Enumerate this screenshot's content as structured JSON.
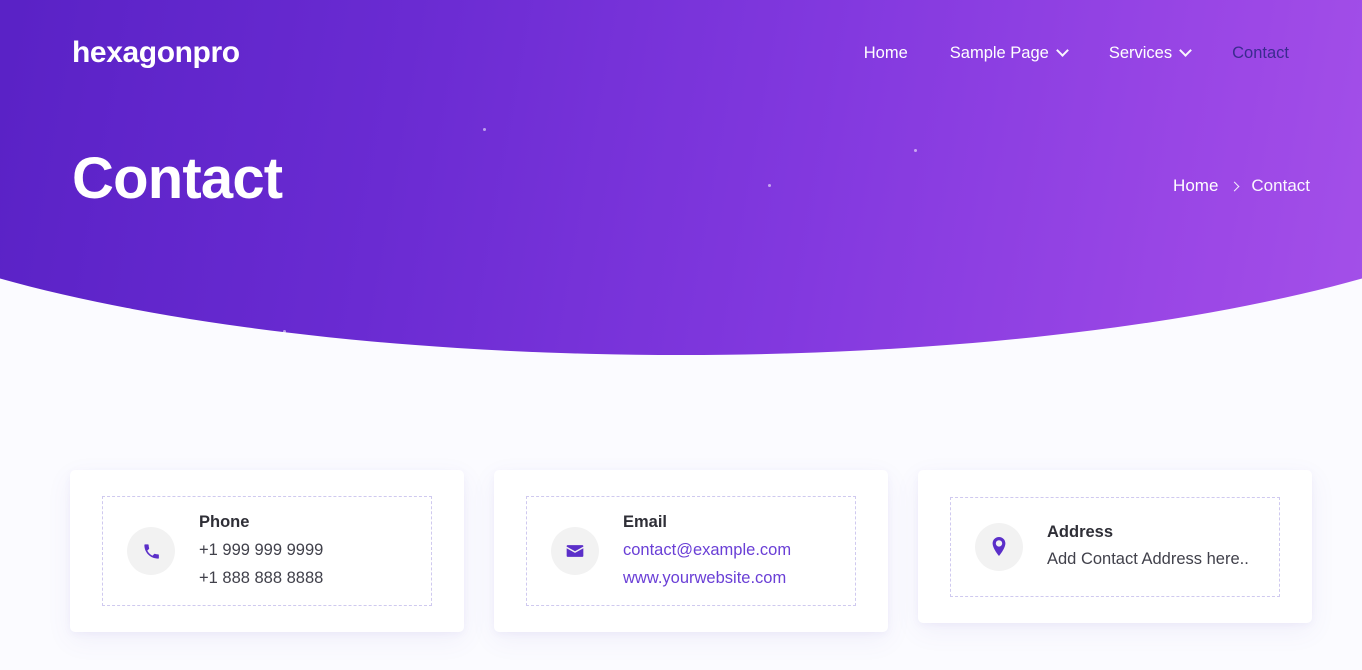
{
  "site": {
    "brand": "hexagonpro",
    "accent": "#6a3fd6",
    "hero_gradient_start": "#5321c2",
    "hero_gradient_end": "#ae5bec",
    "active_nav_color": "#3a2b8f",
    "page_background": "#fbfbff"
  },
  "nav": {
    "items": [
      {
        "label": "Home",
        "has_dropdown": false,
        "active": false
      },
      {
        "label": "Sample Page",
        "has_dropdown": true,
        "active": false
      },
      {
        "label": "Services",
        "has_dropdown": true,
        "active": false
      },
      {
        "label": "Contact",
        "has_dropdown": false,
        "active": true
      }
    ]
  },
  "hero": {
    "title": "Contact",
    "breadcrumb": {
      "home": "Home",
      "separator": "›",
      "current": "Contact"
    }
  },
  "cards": [
    {
      "icon": "phone-icon",
      "title": "Phone",
      "lines": [
        {
          "text": "+1 999 999 9999",
          "is_link": false
        },
        {
          "text": "+1 888 888 8888",
          "is_link": false
        }
      ]
    },
    {
      "icon": "envelope-icon",
      "title": "Email",
      "lines": [
        {
          "text": "contact@example.com",
          "is_link": true
        },
        {
          "text": "www.yourwebsite.com",
          "is_link": true
        }
      ]
    },
    {
      "icon": "map-pin-icon",
      "title": "Address",
      "lines": [
        {
          "text": "Add Contact Address here..",
          "is_link": false
        }
      ]
    }
  ]
}
